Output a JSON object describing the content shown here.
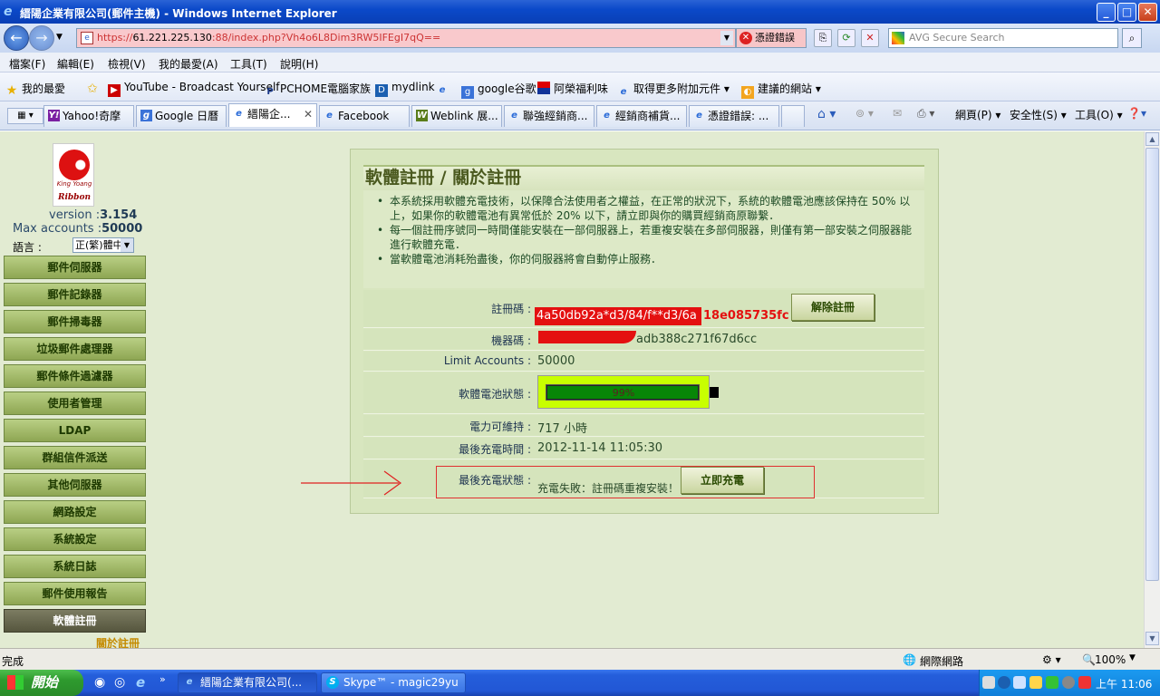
{
  "window": {
    "title": "縉陽企業有限公司(郵件主機) - Windows Internet Explorer",
    "minimize": "_",
    "maximize": "□",
    "close": "✕"
  },
  "address": {
    "url_prefix": "https://",
    "url_host": "61.221.225.130",
    "url_rest": ":88/index.php?Vh4o6L8Dim3RW5IFEgI7qQ==",
    "cert_error": "憑證錯誤",
    "search_placeholder": "AVG Secure Search"
  },
  "menu": [
    "檔案(F)",
    "編輯(E)",
    "檢視(V)",
    "我的最愛(A)",
    "工具(T)",
    "說明(H)"
  ],
  "favorites": {
    "label": "我的最愛",
    "items": [
      "YouTube - Broadcast Yourself",
      "PCHOME電腦家族",
      "mydlink",
      "google谷歌",
      "阿榮福利味",
      "取得更多附加元件 ▾",
      "建議的網站 ▾"
    ]
  },
  "tabs": [
    "Yahoo!奇摩",
    "Google 日曆",
    "縉陽企...",
    "Facebook",
    "Weblink 展...",
    "聯強經銷商...",
    "經銷商補貨...",
    "憑證錯誤: ..."
  ],
  "commands": [
    "網頁(P) ▾",
    "安全性(S) ▾",
    "工具(O) ▾"
  ],
  "sidebar": {
    "logo_text": "Ribbon",
    "logo_small": "King Yoang",
    "version_label": "version :",
    "version_value": "3.154",
    "max_label": "Max accounts :",
    "max_value": "50000",
    "lang_label": "語言 :",
    "lang_value": "正(繁)體中文",
    "items": [
      "郵件伺服器",
      "郵件記錄器",
      "郵件掃毒器",
      "垃圾郵件處理器",
      "郵件條件過濾器",
      "使用者管理",
      "LDAP",
      "群組信件派送",
      "其他伺服器",
      "網路設定",
      "系統設定",
      "系統日誌",
      "郵件使用報告",
      "軟體註冊"
    ],
    "active_index": 13,
    "sub_item": "關於註冊"
  },
  "panel": {
    "title": "軟體註冊 / 關於註冊",
    "bullets": [
      "本系統採用軟體充電技術，以保障合法使用者之權益，在正常的狀況下，系統的軟體電池應該保持在 50% 以上，如果你的軟體電池有異常低於 20% 以下，請立即與你的購買經銷商原聯繫．",
      "每一個註冊序號同一時間僅能安裝在一部伺服器上，若重複安裝在多部伺服器，則僅有第一部安裝之伺服器能進行軟體充電．",
      "當軟體電池消耗殆盡後，你的伺服器將會自動停止服務．"
    ],
    "reg_code_label": "註冊碼 :",
    "reg_code_redacted": "4a50db92a*d3/84/f**d3/6a",
    "reg_code_tail": "18e085735fc",
    "unregister_button": "解除註冊",
    "machine_code_label": "機器碼 :",
    "machine_code_tail": "adb388c271f67d6cc",
    "limit_label": "Limit Accounts :",
    "limit_value": "50000",
    "battery_label": "軟體電池狀態 :",
    "battery_percent_text": "99%",
    "battery_level": 0.99,
    "hours_label": "電力可維持 :",
    "hours_value": "717 小時",
    "last_charge_time_label": "最後充電時間 :",
    "last_charge_time_value": "2012-11-14 11:05:30",
    "last_charge_status_label": "最後充電狀態 :",
    "last_charge_status_value": "充電失敗：註冊碼重複安裝！",
    "charge_button": "立即充電"
  },
  "status": {
    "text": "完成",
    "zone": "網際網路",
    "zoom": "100%"
  },
  "taskbar": {
    "start": "開始",
    "items": [
      "縉陽企業有限公司(...",
      "Skype™ - magic29yu"
    ],
    "clock": "上午 11:06"
  }
}
